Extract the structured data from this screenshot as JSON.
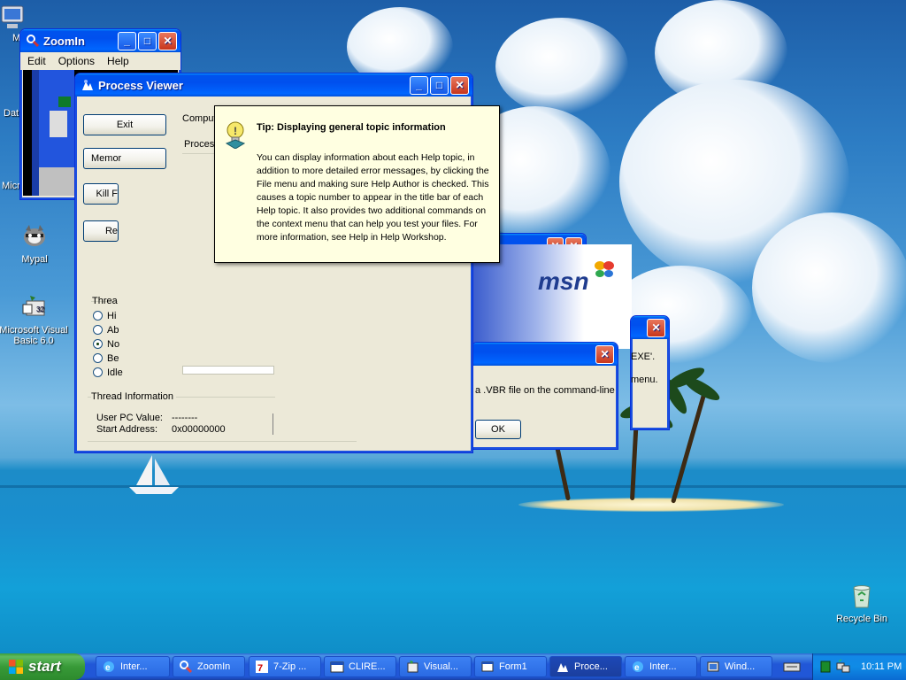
{
  "desktop": {
    "icons": [
      {
        "label": "My",
        "icon": "my-computer-icon"
      },
      {
        "label": "Dat",
        "icon": "data-icon"
      },
      {
        "label": "Micro",
        "icon": "microsoft-icon"
      },
      {
        "label": "Mypal",
        "icon": "mypal-raccoon-icon"
      },
      {
        "label": "Microsoft Visual Basic 6.0",
        "icon": "visual-basic-icon"
      },
      {
        "label": "Recycle Bin",
        "icon": "recycle-bin-icon"
      }
    ]
  },
  "zoomin": {
    "title": "ZoomIn",
    "menu": [
      "Edit",
      "Options",
      "Help"
    ]
  },
  "process_viewer": {
    "title": "Process Viewer",
    "buttons": {
      "exit": "Exit",
      "memory": "Memor",
      "kill": "Kill F",
      "refresh": "Re"
    },
    "labels": {
      "computer": "Comput",
      "process": "Proces"
    },
    "thread_priority": {
      "title": "Threa",
      "options": [
        "Hi",
        "Ab",
        "No",
        "Be",
        "Idle"
      ],
      "selected": "No"
    },
    "thread_info": {
      "title": "Thread Information",
      "user_pc_label": "User PC Value:",
      "user_pc_value": "--------",
      "start_address_label": "Start Address:",
      "start_address_value": "0x00000000"
    }
  },
  "tip": {
    "title": "Tip: Displaying general topic information",
    "body": "You can display information about each Help topic, in addition to more detailed error messages, by clicking the File menu and making sure Help Author is checked. This causes a topic number to appear in the title bar of each Help topic. It also provides two additional commands on the context menu that can help you test your files. For more information, see Help in Help Workshop."
  },
  "msn": {
    "logo_text": "msn"
  },
  "dialog_back": {
    "text1": "EXE'.",
    "text2": "menu."
  },
  "dialog_front": {
    "message": "a .VBR file on the command-line",
    "ok": "OK"
  },
  "taskbar": {
    "start_label": "start",
    "tasks": [
      {
        "label": "Inter...",
        "icon": "internet-explorer-icon"
      },
      {
        "label": "ZoomIn",
        "icon": "zoomin-icon"
      },
      {
        "label": "7-Zip ...",
        "icon": "7zip-icon"
      },
      {
        "label": "CLIRE...",
        "icon": "window-icon"
      },
      {
        "label": "Visual...",
        "icon": "visual-basic-icon"
      },
      {
        "label": "Form1",
        "icon": "form-icon"
      },
      {
        "label": "Proce...",
        "icon": "process-viewer-icon"
      },
      {
        "label": "Inter...",
        "icon": "internet-explorer-icon"
      },
      {
        "label": "Wind...",
        "icon": "windows-icon"
      }
    ],
    "clock": "10:11 PM"
  }
}
